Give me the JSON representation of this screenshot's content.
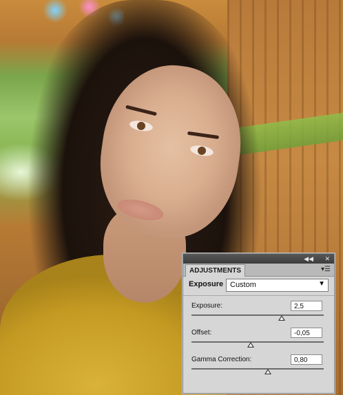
{
  "panel": {
    "tab_label": "ADJUSTMENTS",
    "collapse_icon": "double-chevron-left",
    "close_icon": "close",
    "menu_icon": "panel-menu",
    "adjustment_name": "Exposure",
    "preset_selected": "Custom",
    "sliders": [
      {
        "label": "Exposure:",
        "value": "2,5",
        "level": 0.68
      },
      {
        "label": "Offset:",
        "value": "-0,05",
        "level": 0.45
      },
      {
        "label": "Gamma Correction:",
        "value": "0,80",
        "level": 0.58
      }
    ]
  }
}
